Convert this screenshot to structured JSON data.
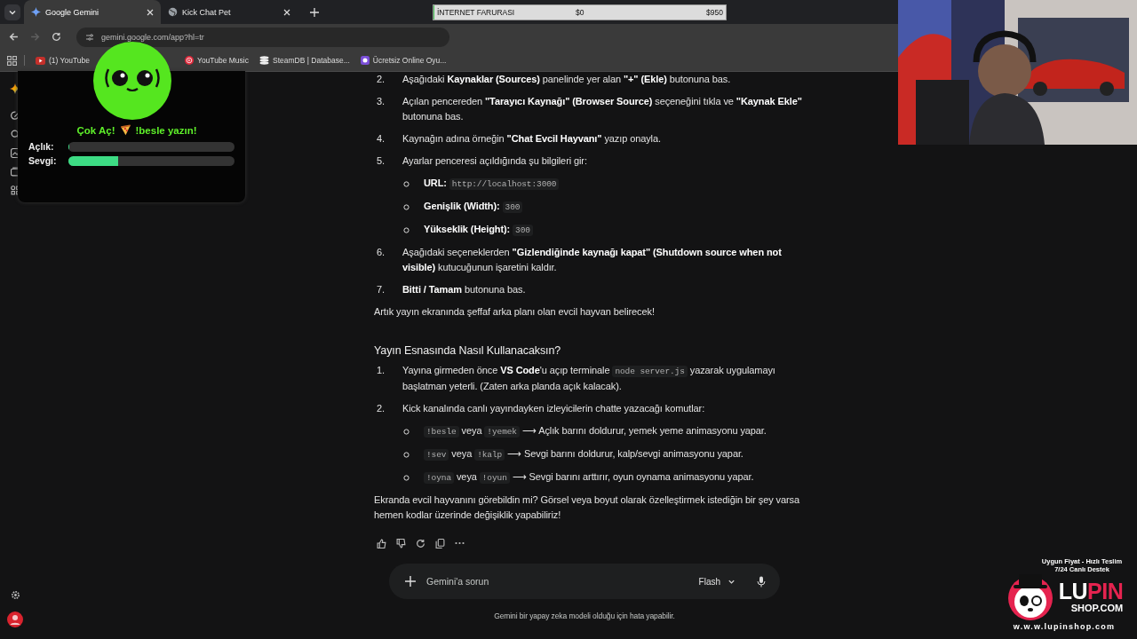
{
  "browser": {
    "tabs": [
      {
        "title": "Google Gemini",
        "selected": true,
        "kind": "gemini"
      },
      {
        "title": "Kick Chat Pet",
        "selected": false,
        "kind": "globe"
      }
    ],
    "address": "gemini.google.com/app?hl=tr",
    "bookmarks": [
      {
        "title": "(1) YouTube",
        "kind": "youtube"
      },
      {
        "title": "YouTube Music",
        "kind": "music"
      },
      {
        "title": "SteamDB | Database...",
        "kind": "steam"
      },
      {
        "title": "Ücretsiz Online Oyu...",
        "kind": "game"
      }
    ]
  },
  "donation_bar": {
    "title": "İNTERNET FARURASI",
    "start": "$0",
    "goal": "$950",
    "level": 0
  },
  "pet_overlay": {
    "message": "Çok Aç!",
    "command": "!besle yazın!",
    "meters": [
      {
        "label": "Açlık:",
        "level": 0
      },
      {
        "label": "Sevgi:",
        "level": 0.3
      }
    ]
  },
  "response": {
    "blocks": [
      {
        "kind": "list",
        "items": [
          {
            "number": "2.",
            "parts": [
              {
                "kind": "text",
                "text": "Aşağıdaki **Kaynaklar (Sources)** panelinde yer alan **\"+\" (Ekle)** butonuna bas."
              }
            ]
          },
          {
            "number": "3.",
            "parts": [
              {
                "kind": "text",
                "text": "Açılan pencereden **\"Tarayıcı Kaynağı\" (Browser Source)** seçeneğini tıkla ve **\"Kaynak Ekle\"** butonuna bas."
              }
            ]
          },
          {
            "number": "4.",
            "parts": [
              {
                "kind": "text",
                "text": "Kaynağın adına örneğin **\"Chat Evcil Hayvanı\"** yazıp onayla."
              }
            ]
          },
          {
            "number": "5.",
            "parts": [
              {
                "kind": "text",
                "text": "Ayarlar penceresi açıldığında şu bilgileri gir:"
              }
            ],
            "children": [
              {
                "parts": [
                  {
                    "kind": "text",
                    "text": "**URL:** "
                  },
                  {
                    "kind": "code",
                    "text": "http://localhost:3000"
                  }
                ]
              },
              {
                "parts": [
                  {
                    "kind": "text",
                    "text": "**Genişlik (Width):** "
                  },
                  {
                    "kind": "code",
                    "text": "300"
                  }
                ]
              },
              {
                "parts": [
                  {
                    "kind": "text",
                    "text": "**Yükseklik (Height):** "
                  },
                  {
                    "kind": "code",
                    "text": "300"
                  }
                ]
              }
            ]
          },
          {
            "number": "6.",
            "parts": [
              {
                "kind": "text",
                "text": "Aşağıdaki seçeneklerden **\"Gizlendiğinde kaynağı kapat\" (Shutdown source when not visible)** kutucuğunun işaretini kaldır."
              }
            ]
          },
          {
            "number": "7.",
            "parts": [
              {
                "kind": "text",
                "text": "**Bitti / Tamam** butonuna bas."
              }
            ]
          }
        ]
      },
      {
        "kind": "paragraph",
        "text": "Artık yayın ekranında şeffaf arka planı olan evcil hayvan belirecek!"
      },
      {
        "kind": "heading",
        "text": "Yayın Esnasında Nasıl Kullanacaksın?"
      },
      {
        "kind": "list",
        "items": [
          {
            "number": "1.",
            "parts": [
              {
                "kind": "text",
                "text": "Yayına girmeden önce **VS Code**'u açıp terminale "
              },
              {
                "kind": "code",
                "text": "node server.js"
              },
              {
                "kind": "text",
                "text": " yazarak uygulamayı başlatman yeterli. (Zaten arka planda açık kalacak)."
              }
            ]
          },
          {
            "number": "2.",
            "parts": [
              {
                "kind": "text",
                "text": "Kick kanalında canlı yayındayken izleyicilerin chatte yazacağı komutlar:"
              }
            ],
            "children": [
              {
                "parts": [
                  {
                    "kind": "code",
                    "text": "!besle"
                  },
                  {
                    "kind": "text",
                    "text": " veya "
                  },
                  {
                    "kind": "code",
                    "text": "!yemek"
                  },
                  {
                    "kind": "text",
                    "text": " ⟶ Açlık barını doldurur, yemek yeme animasyonu yapar."
                  }
                ]
              },
              {
                "parts": [
                  {
                    "kind": "code",
                    "text": "!sev"
                  },
                  {
                    "kind": "text",
                    "text": " veya "
                  },
                  {
                    "kind": "code",
                    "text": "!kalp"
                  },
                  {
                    "kind": "text",
                    "text": " ⟶ Sevgi barını doldurur, kalp/sevgi animasyonu yapar."
                  }
                ]
              },
              {
                "parts": [
                  {
                    "kind": "code",
                    "text": "!oyna"
                  },
                  {
                    "kind": "text",
                    "text": " veya "
                  },
                  {
                    "kind": "code",
                    "text": "!oyun"
                  },
                  {
                    "kind": "text",
                    "text": " ⟶ Sevgi barını arttırır, oyun oynama animasyonu yapar."
                  }
                ]
              }
            ]
          }
        ]
      },
      {
        "kind": "paragraph",
        "text": "Ekranda evcil hayvanını görebildin mi? Görsel veya boyut olarak özelleştirmek istediğin bir şey varsa hemen kodlar üzerinde değişiklik yapabiliriz!"
      }
    ]
  },
  "composer": {
    "placeholder": "Gemini'a sorun",
    "model": "Flash"
  },
  "disclaimer": "Gemini bir yapay zeka modeli olduğu için hata yapabilir.",
  "sponsor": {
    "tagline": "Uygun Fiyat - Hızlı Teslim",
    "tagline_2": "7/24 Canlı Destek",
    "brand": [
      {
        "text": "LU",
        "color": "#ffffff"
      },
      {
        "text": "PIN",
        "color": "#e5234f"
      }
    ],
    "domain": "SHOP.COM",
    "url": "w.w.w.lupinshop.com"
  }
}
